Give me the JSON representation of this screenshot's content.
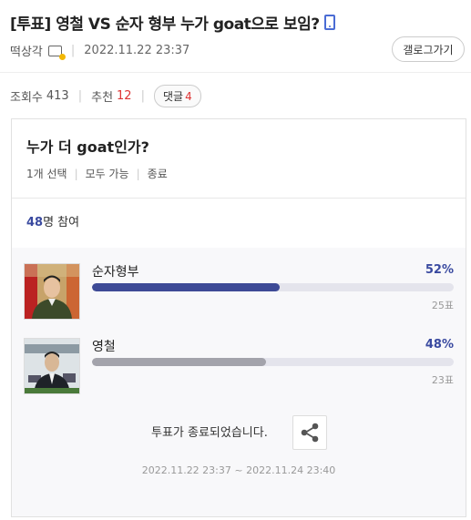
{
  "post": {
    "title": "[투표] 영철 VS 순자 형부 누가 goat으로 보임?",
    "author": "떡상각",
    "date": "2022.11.22 23:37",
    "gallery_button": "갤로그가기",
    "views_label": "조회수",
    "views": "413",
    "recommend_label": "추천",
    "recommend": "12",
    "comments_label": "댓글",
    "comments": "4"
  },
  "poll": {
    "question": "누가 더 goat인가?",
    "options": [
      "1개 선택",
      "모두 가능",
      "종료"
    ],
    "participants_count": "48",
    "participants_suffix": "명 참여",
    "candidates": [
      {
        "name": "순자형부",
        "percent_text": "52%",
        "percent": 52,
        "votes": "25표",
        "bar_color": "#3d4a96"
      },
      {
        "name": "영철",
        "percent_text": "48%",
        "percent": 48,
        "votes": "23표",
        "bar_color": "#a3a3ab"
      }
    ],
    "ended_text": "투표가 종료되었습니다.",
    "period": "2022.11.22 23:37 ~ 2022.11.24 23:40"
  },
  "icons": [
    "mobile-icon",
    "image-attachment-icon",
    "share-icon"
  ]
}
